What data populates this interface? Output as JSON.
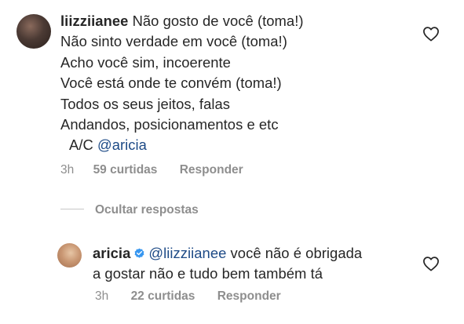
{
  "main_comment": {
    "username": "liizziianee",
    "lines": [
      "Não gosto de você (toma!)",
      "Não sinto verdade em você (toma!)",
      "Acho você sim, incoerente",
      "Você está onde te convém (toma!)",
      "Todos os seus jeitos, falas",
      "Andandos, posicionamentos e etc"
    ],
    "ac_prefix": "A/C ",
    "ac_mention": "@aricia",
    "time": "3h",
    "likes": "59 curtidas",
    "reply_label": "Responder"
  },
  "hide_replies_label": "Ocultar respostas",
  "reply_comment": {
    "username": "aricia",
    "verified": true,
    "mention": "@liizziianee",
    "text_line1": " você não é obrigada",
    "text_line2": "a gostar não e tudo bem também tá",
    "time": "3h",
    "likes": "22 curtidas",
    "reply_label": "Responder"
  },
  "icons": {
    "like": "heart-outline-icon",
    "verified": "verified-badge-icon"
  },
  "colors": {
    "text": "#262626",
    "muted": "#8e8e8e",
    "mention": "#1d4a86",
    "verified": "#3897f0"
  }
}
